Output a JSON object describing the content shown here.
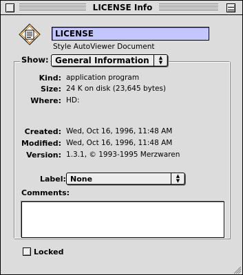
{
  "window": {
    "title": "LICENSE Info"
  },
  "header": {
    "icon": "document-icon",
    "name_value": "LICENSE",
    "document_kind": "Style AutoViewer Document"
  },
  "show": {
    "label": "Show:",
    "selected": "General Information"
  },
  "info": {
    "kind_label": "Kind:",
    "kind_value": "application program",
    "size_label": "Size:",
    "size_value": "24 K on disk (23,645 bytes)",
    "where_label": "Where:",
    "where_value": "HD:",
    "created_label": "Created:",
    "created_value": "Wed, Oct 16, 1996, 11:48 AM",
    "modified_label": "Modified:",
    "modified_value": "Wed, Oct 16, 1996, 11:48 AM",
    "version_label": "Version:",
    "version_value": "1.3.1, © 1993-1995 Merzwaren"
  },
  "label": {
    "label": "Label:",
    "selected": "None"
  },
  "comments": {
    "label": "Comments:",
    "value": ""
  },
  "locked": {
    "label": "Locked",
    "checked": false
  },
  "colors": {
    "window_bg": "#dcdcdc",
    "name_field_highlight": "#c4c6ff"
  }
}
